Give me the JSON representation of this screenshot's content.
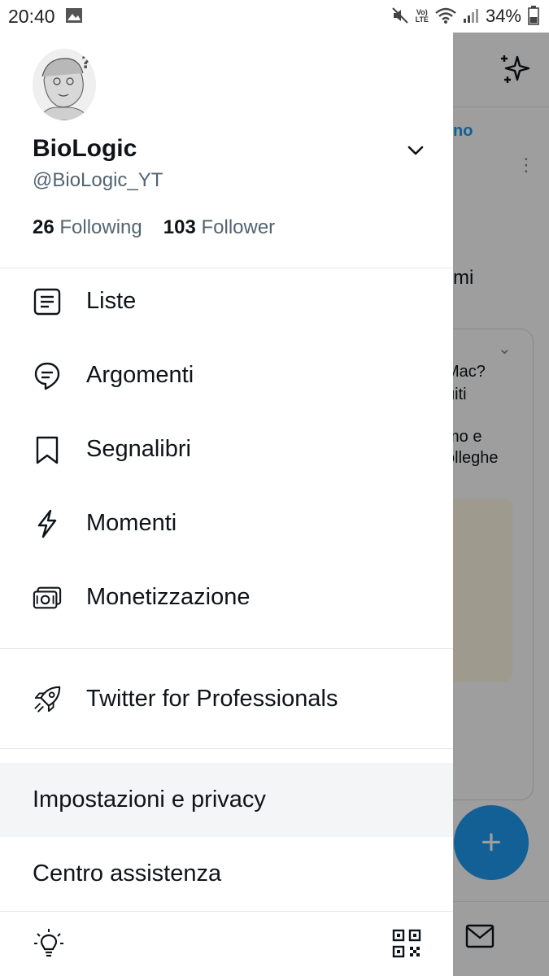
{
  "status_bar": {
    "time": "20:40",
    "volte_line1": "Vo)",
    "volte_line2": "LTE",
    "battery": "34%"
  },
  "profile": {
    "name": "BioLogic",
    "handle": "@BioLogic_YT",
    "following_count": "26",
    "following_label": "Following",
    "follower_count": "103",
    "follower_label": "Follower"
  },
  "menu": {
    "items": [
      {
        "label": "Liste",
        "icon": "list-icon"
      },
      {
        "label": "Argomenti",
        "icon": "topics-icon"
      },
      {
        "label": "Segnalibri",
        "icon": "bookmark-icon"
      },
      {
        "label": "Momenti",
        "icon": "lightning-icon"
      },
      {
        "label": "Monetizzazione",
        "icon": "money-icon"
      }
    ],
    "professional_label": "Twitter for Professionals",
    "settings_label": "Impostazioni e privacy",
    "help_label": "Centro assistenza"
  },
  "background_feed": {
    "header_fragment": "no",
    "text_1": "mi",
    "text_2": "Mac?",
    "text_3": "uiti",
    "text_4": "mo e",
    "text_5": "olleghe"
  },
  "colors": {
    "accent": "#1d9bf0",
    "text_primary": "#0f1419",
    "text_secondary": "#536471"
  }
}
